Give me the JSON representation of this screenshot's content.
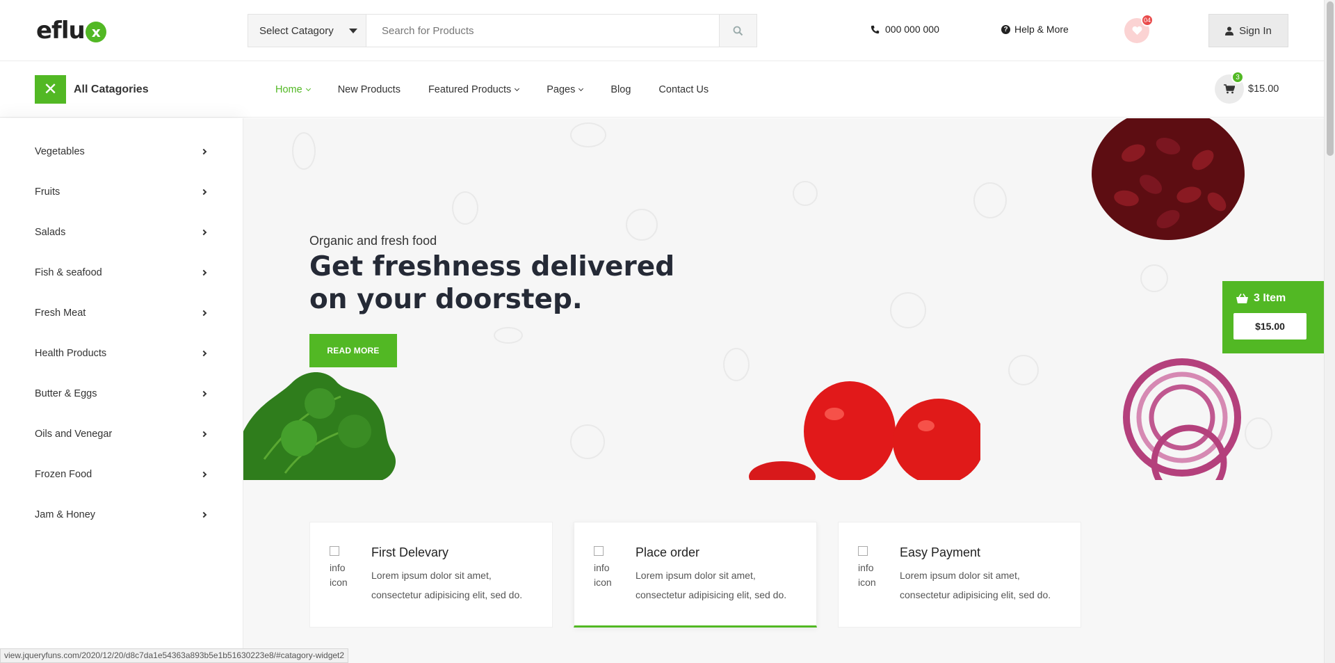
{
  "brand": {
    "logo_text": "eflu",
    "logo_mark": "x",
    "accent_color": "#52b824"
  },
  "search": {
    "category_label": "Select Catagory",
    "placeholder": "Search for Products"
  },
  "header": {
    "phone": "000 000 000",
    "help": "Help & More",
    "wishlist_count": "04",
    "signin_label": "Sign In"
  },
  "nav": {
    "all_categories_label": "All Catagories",
    "items": [
      {
        "label": "Home",
        "dropdown": true,
        "active": true
      },
      {
        "label": "New Products",
        "dropdown": false
      },
      {
        "label": "Featured Products",
        "dropdown": true
      },
      {
        "label": "Pages",
        "dropdown": true
      },
      {
        "label": "Blog",
        "dropdown": false
      },
      {
        "label": "Contact Us",
        "dropdown": false
      }
    ],
    "cart_count": "3",
    "cart_total": "$15.00"
  },
  "sidebar": {
    "items": [
      {
        "label": "Vegetables"
      },
      {
        "label": "Fruits"
      },
      {
        "label": "Salads"
      },
      {
        "label": "Fish & seafood"
      },
      {
        "label": "Fresh Meat"
      },
      {
        "label": "Health Products"
      },
      {
        "label": "Butter & Eggs"
      },
      {
        "label": "Oils and Venegar"
      },
      {
        "label": "Frozen Food"
      },
      {
        "label": "Jam & Honey"
      }
    ]
  },
  "hero": {
    "subtitle": "Organic and fresh food",
    "title": "Get freshness delivered on your doorstep.",
    "button_label": "READ MORE"
  },
  "float_cart": {
    "items_label": "3 Item",
    "price": "$15.00"
  },
  "info_boxes": [
    {
      "icon_alt": "info icon",
      "title": "First Delevary",
      "text": "Lorem ipsum dolor sit amet, consectetur adipisicing elit, sed do."
    },
    {
      "icon_alt": "info icon",
      "title": "Place order",
      "text": "Lorem ipsum dolor sit amet, consectetur adipisicing elit, sed do."
    },
    {
      "icon_alt": "info icon",
      "title": "Easy Payment",
      "text": "Lorem ipsum dolor sit amet, consectetur adipisicing elit, sed do."
    }
  ],
  "status_bar": {
    "url": "view.jqueryfuns.com/2020/12/20/d8c7da1e54363a893b5e1b51630223e8/#catagory-widget2"
  }
}
